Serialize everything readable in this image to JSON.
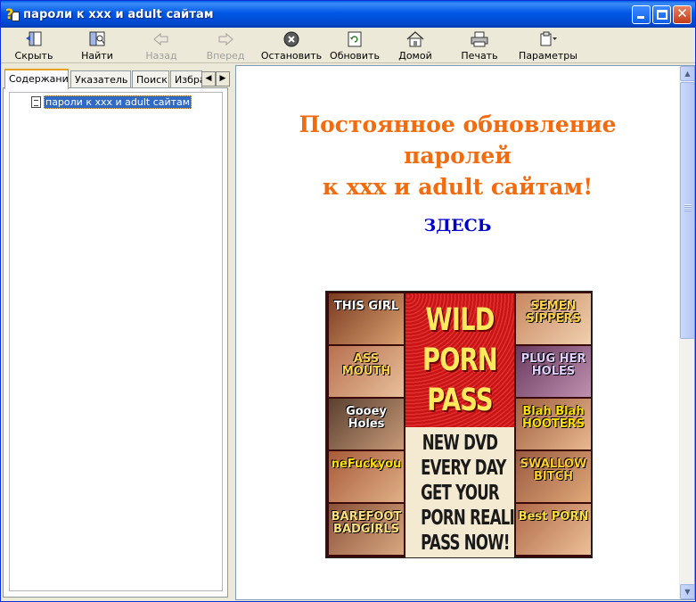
{
  "window": {
    "title": "пароли к xxx и adult сайтам",
    "colors": {
      "titlebar": "#0058e6",
      "headline": "#f26b0e",
      "link": "#0000cc",
      "selection": "#316ac5"
    }
  },
  "toolbar": {
    "hide_label": "Скрыть",
    "find_label": "Найти",
    "back_label": "Назад",
    "forward_label": "Вперед",
    "stop_label": "Остановить",
    "refresh_label": "Обновить",
    "home_label": "Домой",
    "print_label": "Печать",
    "options_label": "Параметры"
  },
  "tabs": {
    "contents": "Содержание",
    "index": "Указатель",
    "search": "Поиск",
    "favorites": "Избранное"
  },
  "tree": {
    "items": [
      {
        "label": "пароли к xxx и adult сайтам",
        "selected": true
      }
    ]
  },
  "content": {
    "headline_line1": "Постоянное обновление",
    "headline_line2": "паролей",
    "headline_line3": "к xxx и adult сайтам!",
    "link_text": "ЗДЕСЬ",
    "banner": {
      "center_top": [
        "WILD",
        "PORN",
        "PASS"
      ],
      "center_bottom": [
        "NEW DVD",
        "EVERY DAY",
        "GET YOUR",
        "PORN REALITY",
        "PASS NOW!"
      ],
      "left_thumbs": [
        "THIS GIRL",
        "ASS MOUTH",
        "Gooey Holes",
        "neFuckyou",
        "BAREFOOT BADGIRLS"
      ],
      "right_thumbs": [
        "SEMEN SIPPERS",
        "PLUG HER HOLES",
        "Blah Blah HOOTERS",
        "SWALLOW BITCH",
        "Best PORN"
      ]
    }
  }
}
